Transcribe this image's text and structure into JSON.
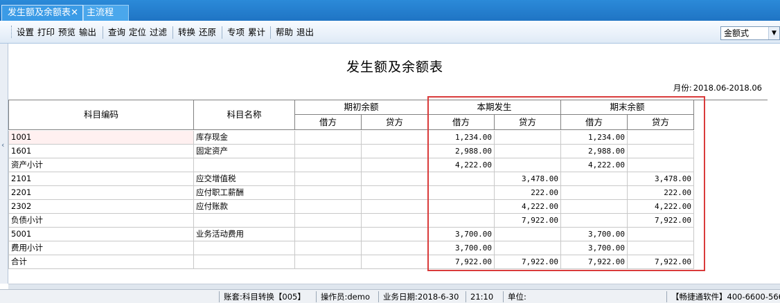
{
  "tabs": [
    {
      "label": "发生额及余额表",
      "active": true
    },
    {
      "label": "主流程",
      "active": false
    }
  ],
  "toolbar": {
    "group1": [
      "设置",
      "打印",
      "预览",
      "输出"
    ],
    "group2": [
      "查询",
      "定位",
      "过滤"
    ],
    "group3": [
      "转换",
      "还原"
    ],
    "group4": [
      "专项",
      "累计"
    ],
    "group5": [
      "帮助",
      "退出"
    ],
    "view_select": "金额式"
  },
  "report": {
    "title": "发生额及余额表",
    "month_label": "月份:",
    "month_value": "2018.06-2018.06"
  },
  "table": {
    "headers": {
      "code": "科目编码",
      "name": "科目名称",
      "opening": "期初余额",
      "period": "本期发生",
      "closing": "期末余额",
      "debit": "借方",
      "credit": "贷方"
    },
    "rows": [
      {
        "code": "1001",
        "name": "库存现金",
        "od": "",
        "oc": "",
        "pd": "1,234.00",
        "pc": "",
        "cd": "1,234.00",
        "cc": ""
      },
      {
        "code": "1601",
        "name": "固定资产",
        "od": "",
        "oc": "",
        "pd": "2,988.00",
        "pc": "",
        "cd": "2,988.00",
        "cc": ""
      },
      {
        "code": "资产小计",
        "name": "",
        "od": "",
        "oc": "",
        "pd": "4,222.00",
        "pc": "",
        "cd": "4,222.00",
        "cc": ""
      },
      {
        "code": "2101",
        "name": "应交增值税",
        "od": "",
        "oc": "",
        "pd": "",
        "pc": "3,478.00",
        "cd": "",
        "cc": "3,478.00"
      },
      {
        "code": "2201",
        "name": "应付职工薪酬",
        "od": "",
        "oc": "",
        "pd": "",
        "pc": "222.00",
        "cd": "",
        "cc": "222.00"
      },
      {
        "code": "2302",
        "name": "应付账款",
        "od": "",
        "oc": "",
        "pd": "",
        "pc": "4,222.00",
        "cd": "",
        "cc": "4,222.00"
      },
      {
        "code": "负债小计",
        "name": "",
        "od": "",
        "oc": "",
        "pd": "",
        "pc": "7,922.00",
        "cd": "",
        "cc": "7,922.00"
      },
      {
        "code": "5001",
        "name": "业务活动费用",
        "od": "",
        "oc": "",
        "pd": "3,700.00",
        "pc": "",
        "cd": "3,700.00",
        "cc": ""
      },
      {
        "code": "费用小计",
        "name": "",
        "od": "",
        "oc": "",
        "pd": "3,700.00",
        "pc": "",
        "cd": "3,700.00",
        "cc": ""
      },
      {
        "code": "合计",
        "name": "",
        "od": "",
        "oc": "",
        "pd": "7,922.00",
        "pc": "7,922.00",
        "cd": "7,922.00",
        "cc": "7,922.00"
      }
    ]
  },
  "status": {
    "account_set": "账套:科目转换【005】",
    "operator": "操作员:demo",
    "business_date": "业务日期:2018-6-30",
    "time": "21:10",
    "unit": "单位:",
    "vendor": "【畅捷通软件】400-6600-566"
  },
  "colors": {
    "tab_blue": "#2b8ad8",
    "highlight_red": "#d93a3a"
  }
}
